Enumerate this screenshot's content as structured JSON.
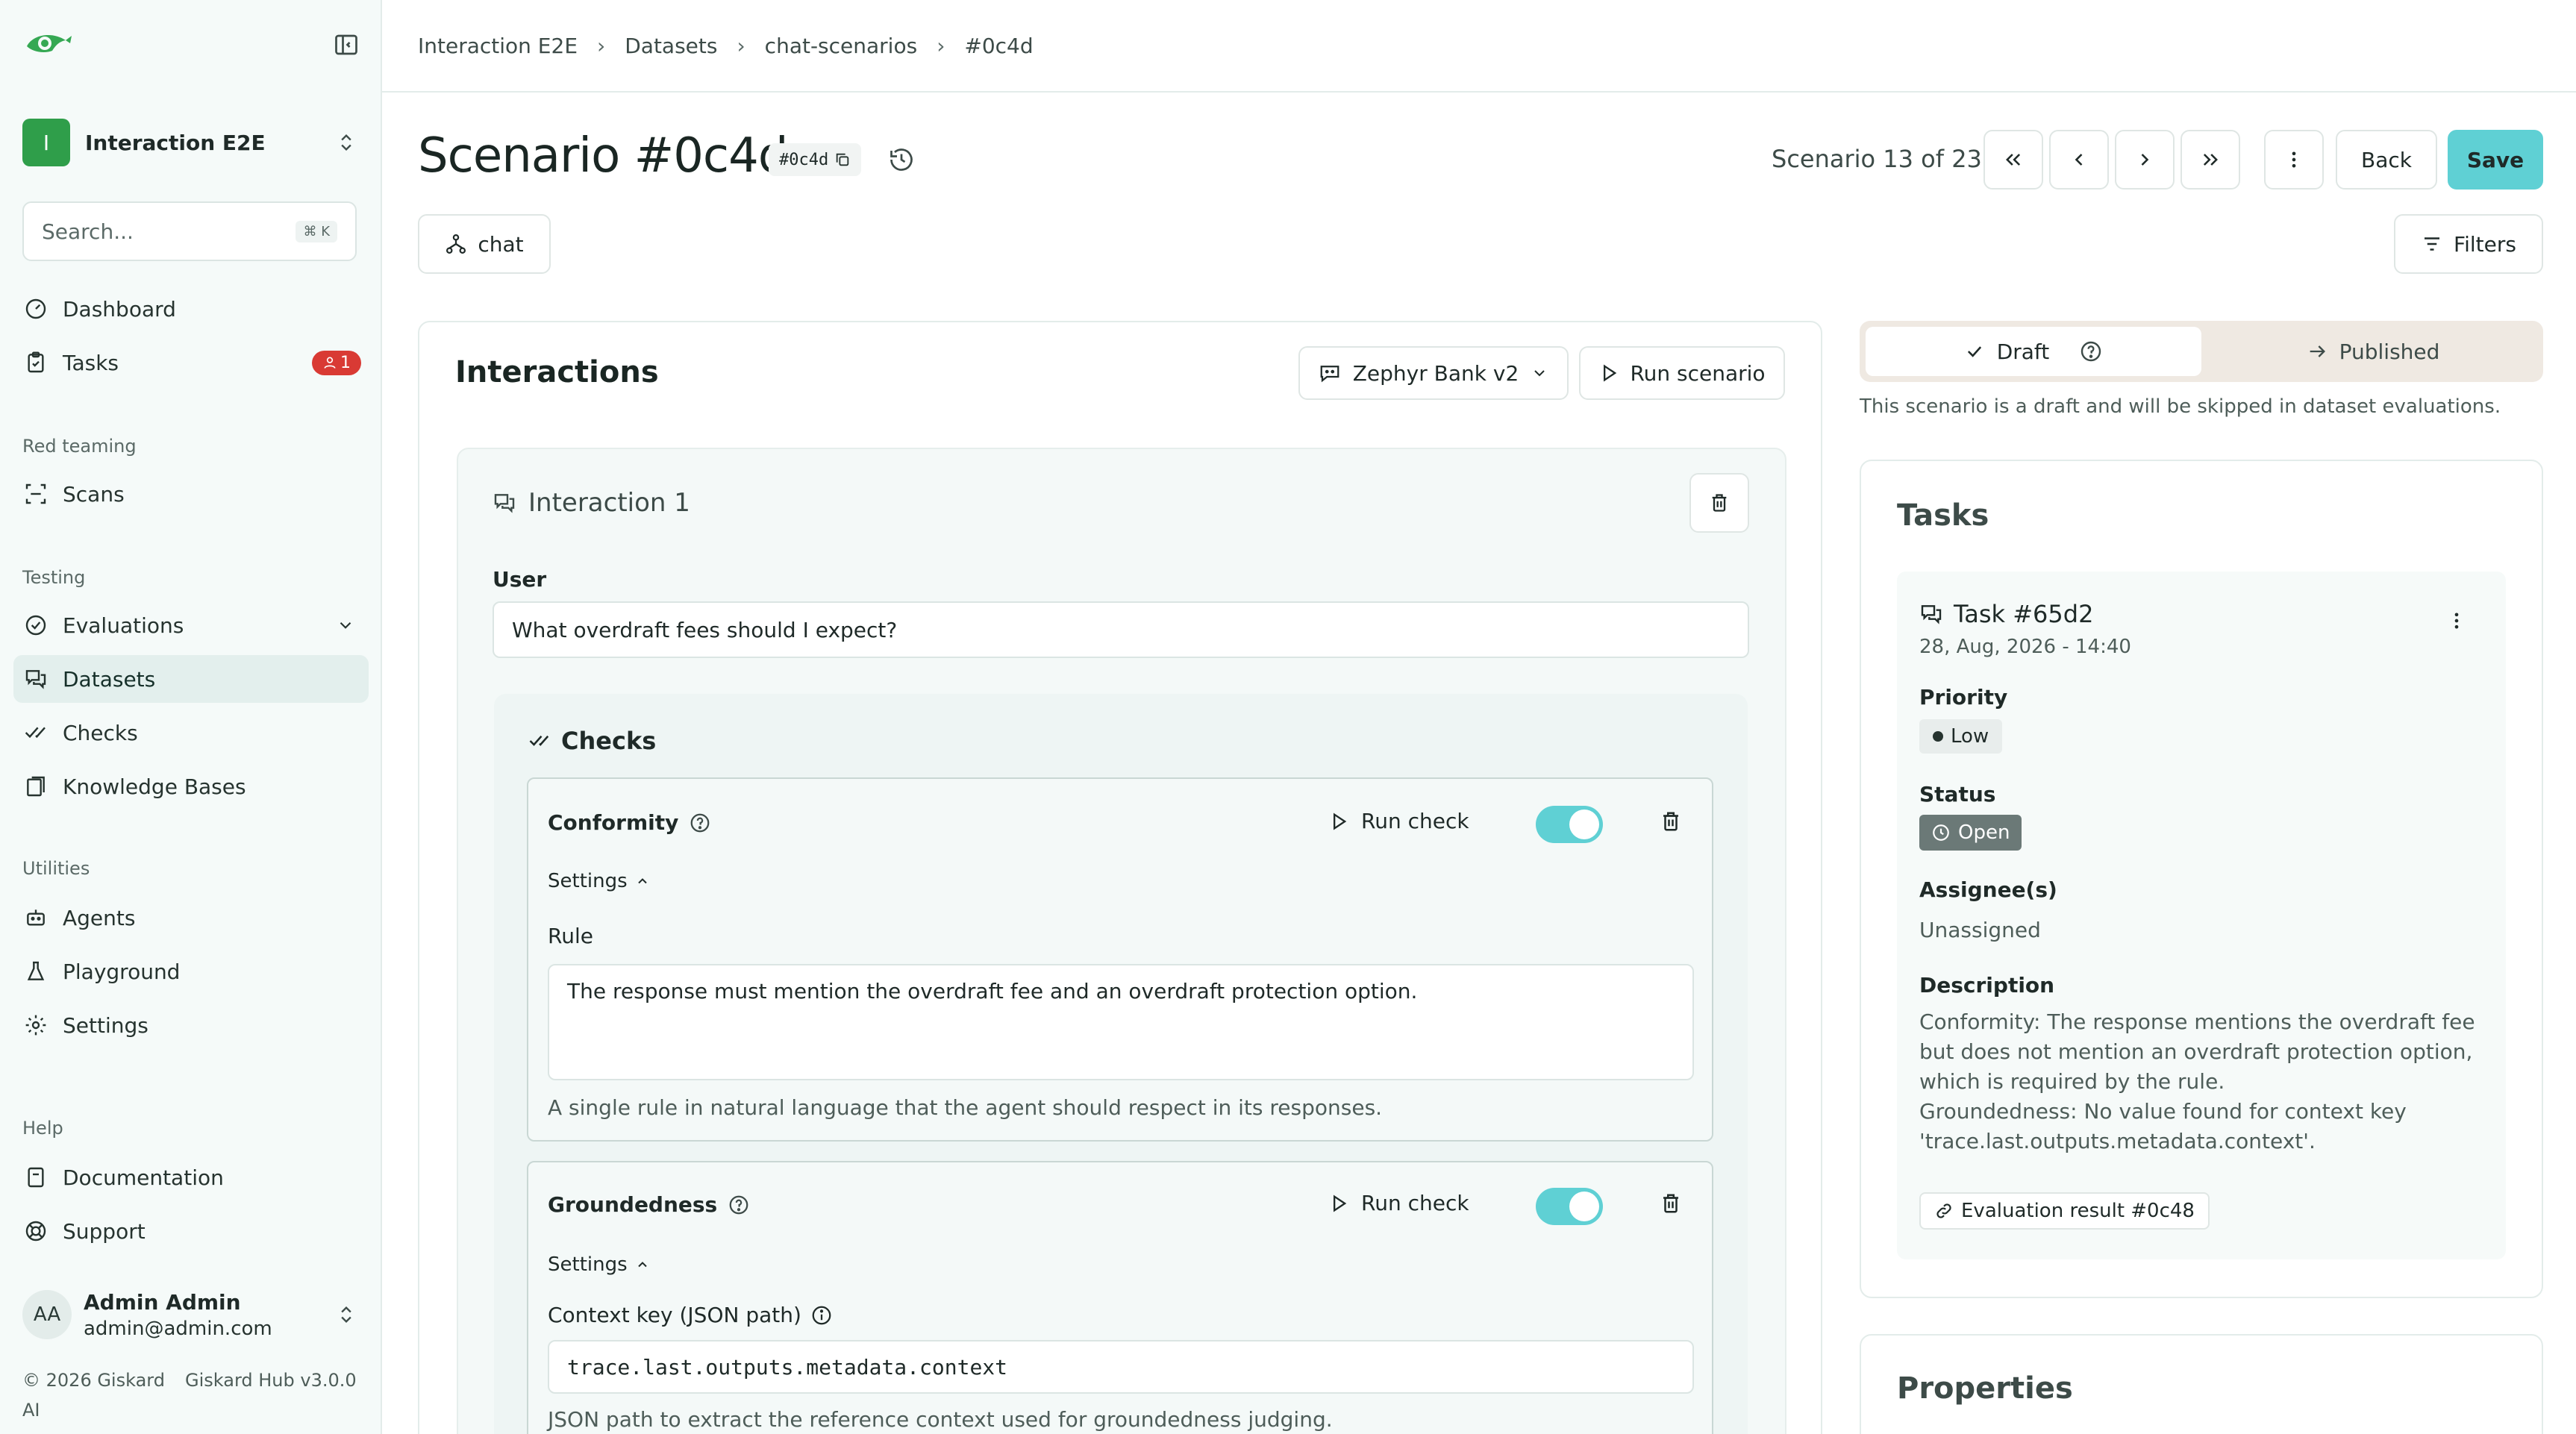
{
  "sidebar": {
    "project": {
      "initial": "I",
      "name": "Interaction E2E"
    },
    "search": {
      "placeholder": "Search...",
      "shortcut": "⌘ K"
    },
    "items": {
      "dashboard": "Dashboard",
      "tasks": "Tasks",
      "tasks_badge": "1",
      "scans": "Scans",
      "evaluations": "Evaluations",
      "datasets": "Datasets",
      "checks": "Checks",
      "knowledge_bases": "Knowledge Bases",
      "agents": "Agents",
      "playground": "Playground",
      "settings": "Settings",
      "documentation": "Documentation",
      "support": "Support"
    },
    "sections": {
      "red_teaming": "Red teaming",
      "testing": "Testing",
      "utilities": "Utilities",
      "help": "Help"
    },
    "user": {
      "initials": "AA",
      "name": "Admin Admin",
      "email": "admin@admin.com"
    },
    "footer": {
      "copyright": "© 2026 Giskard AI",
      "version": "Giskard Hub v3.0.0"
    }
  },
  "breadcrumb": [
    "Interaction E2E",
    "Datasets",
    "chat-scenarios",
    "#0c4d"
  ],
  "header": {
    "title": "Scenario #0c4d",
    "id_chip": "#0c4d",
    "scenario_count": "Scenario 13 of 23",
    "back_label": "Back",
    "save_label": "Save",
    "chat_label": "chat",
    "filters_label": "Filters"
  },
  "interactions": {
    "title": "Interactions",
    "agent_select": "Zephyr Bank v2",
    "run_scenario_label": "Run scenario",
    "interaction_title": "Interaction 1",
    "user_label": "User",
    "user_message": "What overdraft fees should I expect?",
    "checks_title": "Checks",
    "checks": [
      {
        "name": "Conformity",
        "run_label": "Run check",
        "settings_label": "Settings",
        "field_label": "Rule",
        "field_value": "The response must mention the overdraft fee and an overdraft protection option.",
        "helper": "A single rule in natural language that the agent should respect in its responses.",
        "enabled": true
      },
      {
        "name": "Groundedness",
        "run_label": "Run check",
        "settings_label": "Settings",
        "field_label": "Context key (JSON path)",
        "field_value": "trace.last.outputs.metadata.context",
        "helper": "JSON path to extract the reference context used for groundedness judging.",
        "enabled": true
      }
    ]
  },
  "publish": {
    "draft_label": "Draft",
    "published_label": "Published",
    "note": "This scenario is a draft and will be skipped in dataset evaluations."
  },
  "tasks": {
    "title": "Tasks",
    "task_title": "Task #65d2",
    "date": "28, Aug, 2026 - 14:40",
    "priority_label": "Priority",
    "priority_value": "Low",
    "status_label": "Status",
    "status_value": "Open",
    "assignee_label": "Assignee(s)",
    "assignee_value": "Unassigned",
    "description_label": "Description",
    "description_lines": [
      "Conformity: The response mentions the overdraft fee",
      "but does not mention an overdraft protection option,",
      "which is required by the rule.",
      "Groundedness: No value found for context key",
      "'trace.last.outputs.metadata.context'."
    ],
    "eval_link": "Evaluation result #0c48"
  },
  "properties": {
    "title": "Properties"
  },
  "colors": {
    "accent": "#5fd0d4",
    "brand_green": "#2f9e4a",
    "badge_red": "#d93a34"
  }
}
